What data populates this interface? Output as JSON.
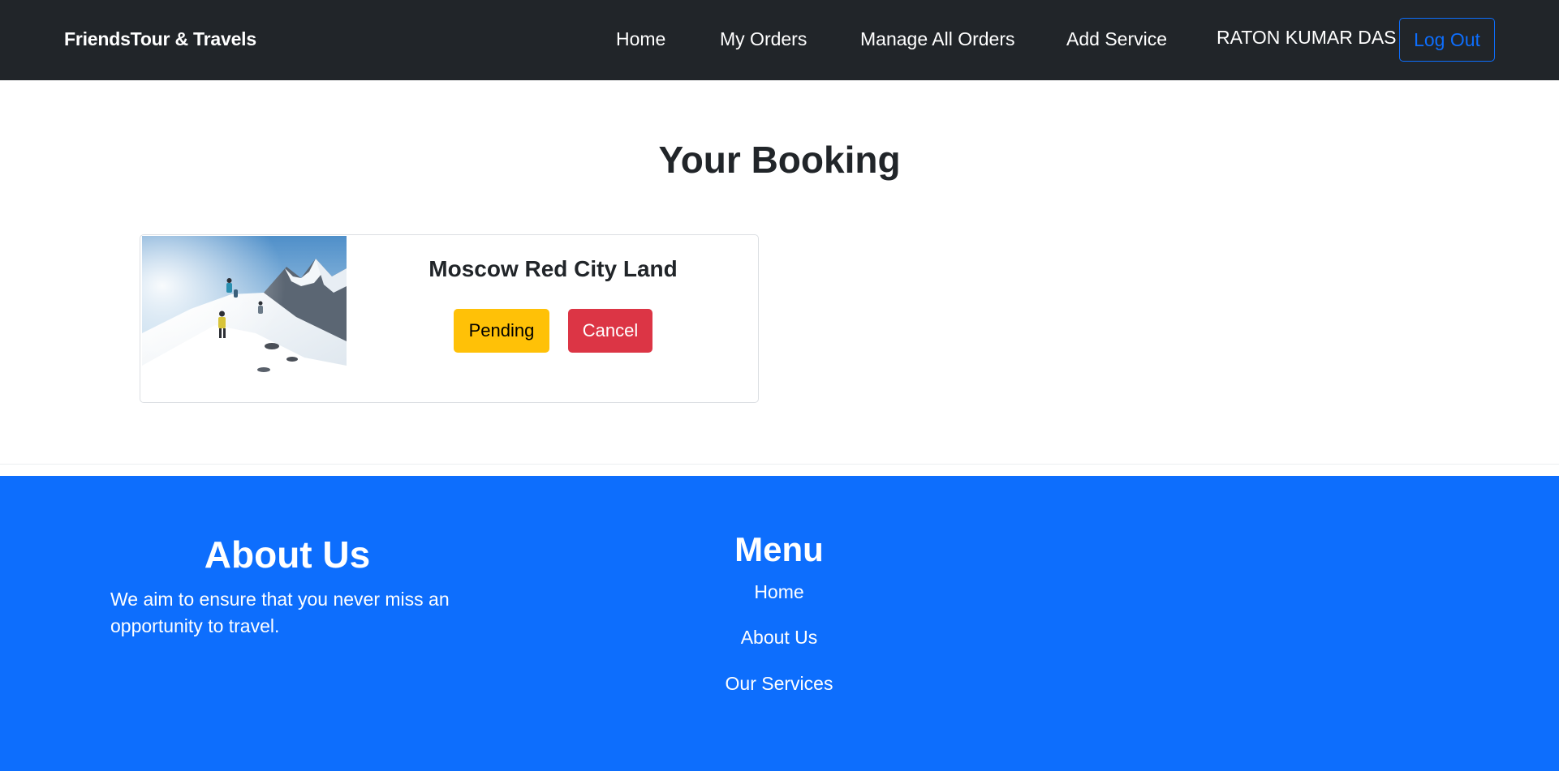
{
  "navbar": {
    "brand": "FriendsTour & Travels",
    "links": [
      "Home",
      "My Orders",
      "Manage All Orders",
      "Add Service"
    ],
    "user_name": "RATON KUMAR DAS",
    "logout_label": "Log Out"
  },
  "main": {
    "title": "Your Booking",
    "booking": {
      "title": "Moscow Red City Land",
      "status_label": "Pending",
      "cancel_label": "Cancel"
    }
  },
  "footer": {
    "about_title": "About Us",
    "about_text": "We aim to ensure that you never miss an opportunity to travel.",
    "menu_title": "Menu",
    "menu_links": [
      "Home",
      "About Us",
      "Our Services"
    ]
  },
  "colors": {
    "navbar_bg": "#212529",
    "primary": "#0d6efd",
    "warning": "#ffc107",
    "danger": "#dc3545"
  }
}
